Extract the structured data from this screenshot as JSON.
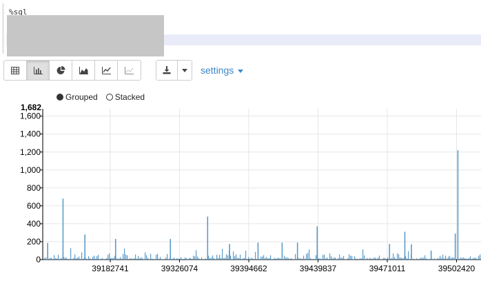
{
  "editor": {
    "code": "%sql"
  },
  "toolbar": {
    "buttons": [
      {
        "icon": "table-icon"
      },
      {
        "icon": "bar-chart-icon",
        "active": true
      },
      {
        "icon": "pie-chart-icon"
      },
      {
        "icon": "area-chart-icon"
      },
      {
        "icon": "line-chart-icon"
      },
      {
        "icon": "scatter-chart-icon"
      }
    ],
    "download_icon": "download-icon",
    "caret_icon": "caret-down-icon",
    "settings_label": "settings"
  },
  "legend": {
    "grouped": "Grouped",
    "stacked": "Stacked"
  },
  "colors": {
    "bar": "#5b9bc9",
    "grid": "#e6e6e6",
    "link": "#3c87c7"
  },
  "chart_data": {
    "type": "bar",
    "ylim": [
      0,
      1682
    ],
    "y_max_label": "1,682",
    "y_ticks": [
      0,
      200,
      400,
      600,
      800,
      1000,
      1200,
      1400,
      1600
    ],
    "y_tick_labels": [
      "0",
      "200",
      "400",
      "600",
      "800",
      "1,000",
      "1,200",
      "1,400",
      "1,600"
    ],
    "x_tick_labels": [
      "39182741",
      "39326074",
      "39394662",
      "39439837",
      "39471011",
      "39502420"
    ],
    "grid": true,
    "highlights": [
      {
        "pos": 0.01,
        "value": 185
      },
      {
        "pos": 0.045,
        "value": 680
      },
      {
        "pos": 0.095,
        "value": 280
      },
      {
        "pos": 0.165,
        "value": 230
      },
      {
        "pos": 0.29,
        "value": 230
      },
      {
        "pos": 0.375,
        "value": 480
      },
      {
        "pos": 0.425,
        "value": 175
      },
      {
        "pos": 0.49,
        "value": 190
      },
      {
        "pos": 0.545,
        "value": 190
      },
      {
        "pos": 0.58,
        "value": 190
      },
      {
        "pos": 0.625,
        "value": 370
      },
      {
        "pos": 0.79,
        "value": 175
      },
      {
        "pos": 0.825,
        "value": 310
      },
      {
        "pos": 0.84,
        "value": 170
      },
      {
        "pos": 0.885,
        "value": 100
      },
      {
        "pos": 0.94,
        "value": 290
      },
      {
        "pos": 0.946,
        "value": 1220
      }
    ]
  }
}
